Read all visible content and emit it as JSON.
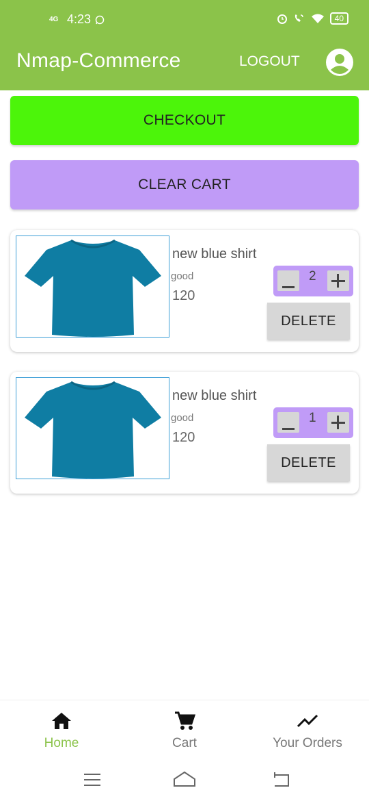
{
  "status_bar": {
    "network": "4G",
    "time": "4:23",
    "battery": "40"
  },
  "app_bar": {
    "title": "Nmap-Commerce",
    "logout_label": "LOGOUT"
  },
  "actions": {
    "checkout_label": "CHECKOUT",
    "clear_cart_label": "CLEAR CART"
  },
  "cart_items": [
    {
      "name": "new blue shirt",
      "description": "good",
      "price": "120",
      "quantity": "2",
      "delete_label": "DELETE"
    },
    {
      "name": "new blue shirt",
      "description": "good",
      "price": "120",
      "quantity": "1",
      "delete_label": "DELETE"
    }
  ],
  "bottom_nav": [
    {
      "label": "Home",
      "icon": "home-icon",
      "active": true
    },
    {
      "label": "Cart",
      "icon": "cart-icon",
      "active": false
    },
    {
      "label": "Your Orders",
      "icon": "trending-up-icon",
      "active": false
    }
  ],
  "colors": {
    "app_bar": "#8bc34a",
    "checkout": "#4cf50a",
    "clear_cart": "#c09bf7",
    "quantity_box": "#c09bf7",
    "shirt": "#0f7da3"
  }
}
